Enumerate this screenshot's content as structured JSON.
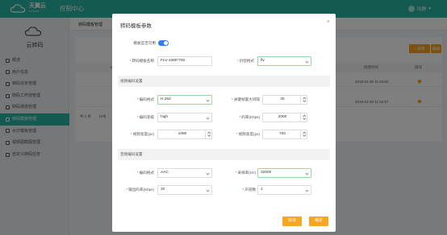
{
  "header": {
    "brand": "天翼云",
    "brand_sub": "e.Cloud",
    "console": "控制中心",
    "user": "陆静",
    "user_caret": "▾"
  },
  "sidebar": {
    "title": "云转码",
    "items": [
      {
        "label": "概述"
      },
      {
        "label": "用户信息"
      },
      {
        "label": "转码任务管理"
      },
      {
        "label": "转码工作流管理"
      },
      {
        "label": "转码通道管理"
      },
      {
        "label": "转码模板管理"
      },
      {
        "label": "水印模板管理"
      },
      {
        "label": "视频图截图管理"
      },
      {
        "label": "自定义转码任务"
      }
    ],
    "active_index": 5
  },
  "main": {
    "tab": "转码模板管理",
    "add_label": "+ 新增",
    "delete_label": "删除",
    "columns": {
      "id": "ID",
      "time": "修改时间",
      "op": "操作"
    },
    "rows": [
      {
        "time": "2019-01-30 11:34:50"
      },
      {
        "time": "2019-01-30 11:34:57"
      }
    ],
    "pager": "共 2 条",
    "pager_size": "10条"
  },
  "modal": {
    "title": "转码模板参数",
    "close": "×",
    "enable_label": "模板是否可用",
    "enabled": true,
    "name_label": "转码模板名称",
    "name_value": "FLV-1080*702",
    "format_label": "封装格式",
    "format_value": "flv",
    "video_section": "视频编码设置",
    "video": {
      "codec_label": "编码格式",
      "codec_value": "H.264",
      "gop_label": "关键帧最大间隔",
      "gop_value": "25",
      "profile_label": "编码等级",
      "profile_value": "high",
      "bitrate_label": "码率(Kbps)",
      "bitrate_value": "2000",
      "width_label": "视频宽度(px)",
      "width_value": "1080",
      "height_label": "视频高度(px)",
      "height_value": "720"
    },
    "audio_section": "音频编码设置",
    "audio": {
      "codec_label": "编码格式",
      "codec_value": "AAC",
      "samplerate_label": "采样率(Hz)",
      "samplerate_value": "32000",
      "bitrate_label": "输出码率(Kbps)",
      "bitrate_value": "32",
      "channels_label": "声道数",
      "channels_value": "1"
    },
    "cancel_label": "取消",
    "confirm_label": "确定"
  },
  "colors": {
    "brand": "#27b5a0",
    "accent": "#f5a623",
    "toggle": "#2e7cf6",
    "required": "#e53935"
  }
}
